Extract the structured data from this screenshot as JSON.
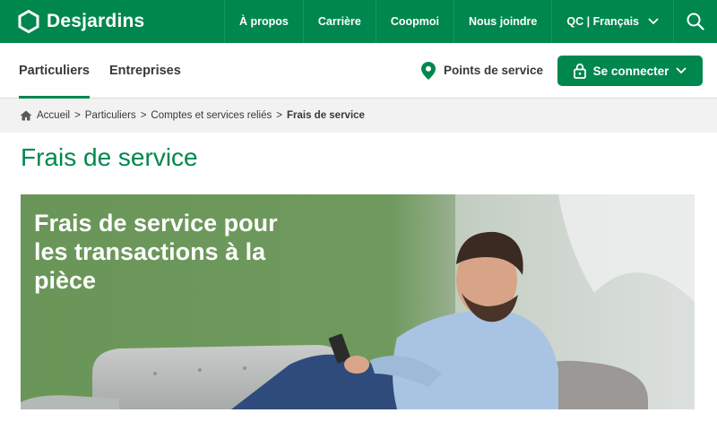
{
  "brand": {
    "name": "Desjardins"
  },
  "topnav": {
    "items": [
      "À propos",
      "Carrière",
      "Coopmoi",
      "Nous joindre"
    ],
    "language": "QC | Français"
  },
  "subnav": {
    "tabs": [
      "Particuliers",
      "Entreprises"
    ],
    "active_tab": "Particuliers",
    "points_label": "Points de service",
    "connect_label": "Se connecter"
  },
  "breadcrumb": {
    "items": [
      "Accueil",
      "Particuliers",
      "Comptes et services reliés"
    ],
    "current": "Frais de service"
  },
  "page": {
    "title": "Frais de service",
    "hero_title": "Frais de service pour les transactions à la pièce"
  },
  "colors": {
    "brand_green": "#00874e",
    "breadcrumb_bg": "#f2f2f2"
  },
  "icons": [
    "desjardins-hexagon-logo",
    "chevron-down-icon",
    "search-icon",
    "location-pin-icon",
    "lock-icon",
    "home-icon"
  ]
}
